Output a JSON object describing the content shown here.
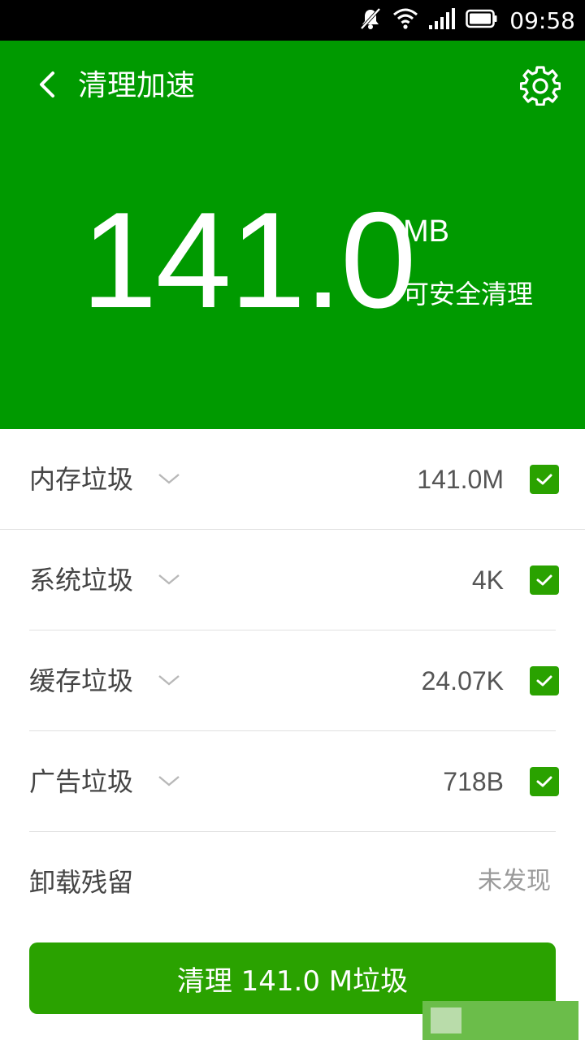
{
  "status_bar": {
    "time": "09:58",
    "icons": [
      "notifications-muted-icon",
      "wifi-icon",
      "signal-icon",
      "battery-icon"
    ]
  },
  "header": {
    "title": "清理加速",
    "back_icon": "chevron-left-icon",
    "settings_icon": "gear-icon",
    "value": "141.0",
    "unit": "MB",
    "subtitle": "可安全清理"
  },
  "items": [
    {
      "name": "内存垃圾",
      "size": "141.0M",
      "checked": true
    },
    {
      "name": "系统垃圾",
      "size": "4K",
      "checked": true
    },
    {
      "name": "缓存垃圾",
      "size": "24.07K",
      "checked": true
    },
    {
      "name": "广告垃圾",
      "size": "718B",
      "checked": true
    }
  ],
  "residual": {
    "name": "卸载残留",
    "status": "未发现"
  },
  "clean_button": {
    "label": "清理 141.0 M垃圾"
  },
  "colors": {
    "header_bg": "#009a00",
    "accent": "#2aa200",
    "status_bar_bg": "#000000"
  }
}
